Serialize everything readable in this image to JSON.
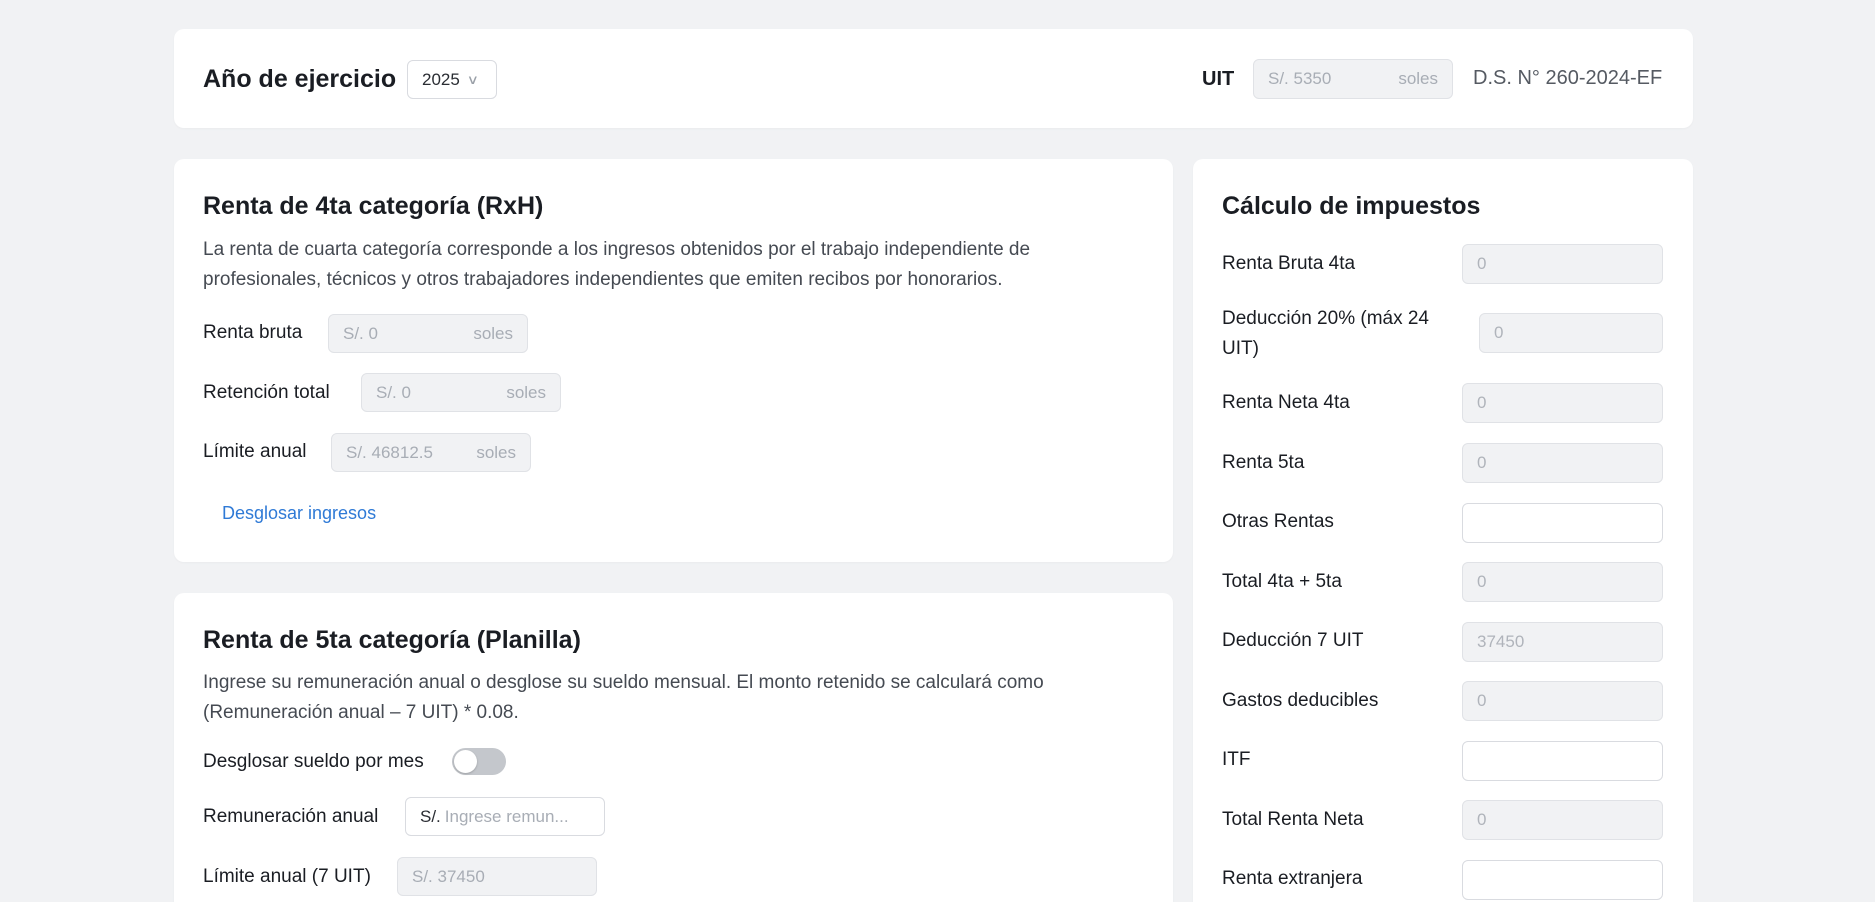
{
  "header": {
    "year_label": "Año de ejercicio",
    "year_value": "2025",
    "uit_label": "UIT",
    "uit_value": "S/. 5350",
    "uit_unit": "soles",
    "decree": "D.S. N° 260-2024-EF"
  },
  "renta_4ta": {
    "title": "Renta de 4ta categoría (RxH)",
    "description": "La renta de cuarta categoría corresponde a los ingresos obtenidos por el trabajo independiente de profesionales, técnicos y otros trabajadores independientes que emiten recibos por honorarios.",
    "fields": [
      {
        "label": "Renta bruta",
        "value": "S/. 0",
        "unit": "soles"
      },
      {
        "label": "Retención total",
        "value": "S/. 0",
        "unit": "soles"
      },
      {
        "label": "Límite anual",
        "value": "S/. 46812.5",
        "unit": "soles"
      }
    ],
    "breakdown_link": "Desglosar ingresos"
  },
  "renta_5ta": {
    "title": "Renta de 5ta categoría (Planilla)",
    "description": "Ingrese su remuneración anual o desglose su sueldo mensual. El monto retenido se calculará como (Remuneración anual – 7 UIT) * 0.08.",
    "toggle_label": "Desglosar sueldo por mes",
    "toggle_on": false,
    "remuneracion_label": "Remuneración anual",
    "remuneracion_prefix": "S/.",
    "remuneracion_placeholder": "Ingrese remun...",
    "limite_label": "Límite anual (7 UIT)",
    "limite_value": "S/. 37450"
  },
  "calculo": {
    "title": "Cálculo de impuestos",
    "rows": [
      {
        "label": "Renta Bruta 4ta",
        "value": "0",
        "editable": false
      },
      {
        "label": "Deducción 20% (máx 24 UIT)",
        "value": "0",
        "editable": false
      },
      {
        "label": "Renta Neta 4ta",
        "value": "0",
        "editable": false
      },
      {
        "label": "Renta 5ta",
        "value": "0",
        "editable": false
      },
      {
        "label": "Otras Rentas",
        "value": "",
        "editable": true
      },
      {
        "label": "Total 4ta + 5ta",
        "value": "0",
        "editable": false
      },
      {
        "label": "Deducción 7 UIT",
        "value": "37450",
        "editable": false
      },
      {
        "label": "Gastos deducibles",
        "value": "0",
        "editable": false
      },
      {
        "label": "ITF",
        "value": "",
        "editable": true
      },
      {
        "label": "Total Renta Neta",
        "value": "0",
        "editable": false
      },
      {
        "label": "Renta extranjera",
        "value": "",
        "editable": true
      }
    ]
  }
}
